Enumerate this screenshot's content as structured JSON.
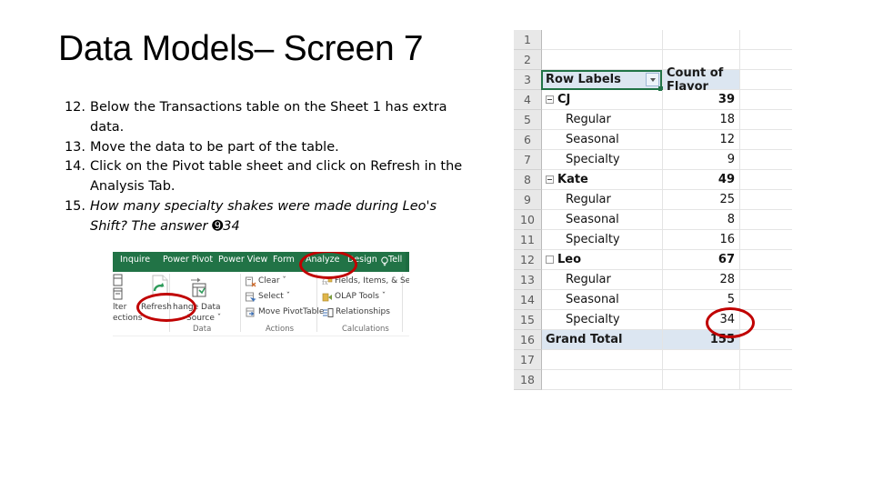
{
  "slide": {
    "title": "Data Models– Screen 7"
  },
  "instructions": [
    {
      "num": "12.",
      "text": "Below the Transactions table on the Sheet 1 has extra data.",
      "italic": false
    },
    {
      "num": "13.",
      "text": "Move the data to be part of the table.",
      "italic": false
    },
    {
      "num": "14.",
      "text": "Click on the Pivot table sheet and click on Refresh in the Analysis Tab.",
      "italic": false
    },
    {
      "num": "15.",
      "text": "How many specialty shakes were made during Leo's Shift? The answer ➒34",
      "italic": true
    }
  ],
  "ribbon": {
    "accent_color": "#217346",
    "highlight_color": "#c00000",
    "tabs": [
      {
        "label": "Inquire",
        "active": false
      },
      {
        "label": "Power Pivot",
        "active": false
      },
      {
        "label": "Power View",
        "active": false
      },
      {
        "label": "Form",
        "active": false
      },
      {
        "label": "Analyze",
        "active": true
      },
      {
        "label": "Design",
        "active": false
      },
      {
        "label": "Tell m",
        "active": false
      }
    ],
    "groups": [
      {
        "label": "Data"
      },
      {
        "label": "Actions"
      },
      {
        "label": "Calculations"
      }
    ],
    "commands": [
      {
        "label": "lter"
      },
      {
        "label": "ections"
      },
      {
        "label": "Refresh"
      },
      {
        "label": "hange Data"
      },
      {
        "label": "Source ˇ"
      },
      {
        "label": "Clear ˇ"
      },
      {
        "label": "Select ˇ"
      },
      {
        "label": "Move PivotTable"
      },
      {
        "label": "Fields, Items, & Sets ˇ"
      },
      {
        "label": "OLAP Tools ˇ"
      },
      {
        "label": "Relationships"
      }
    ],
    "circled": [
      "Analyze",
      "Refresh"
    ]
  },
  "pivot": {
    "header_fill": "#dce6f1",
    "columns": {
      "a": "Row Labels",
      "b": "Count of Flavor"
    },
    "rows": [
      {
        "n": "1",
        "a": "",
        "b": "",
        "kind": "blank",
        "indent": false,
        "expander": ""
      },
      {
        "n": "2",
        "a": "",
        "b": "",
        "kind": "blank",
        "indent": false,
        "expander": ""
      },
      {
        "n": "3",
        "a": "Row Labels",
        "b": "Count of Flavor",
        "kind": "hdr",
        "indent": false,
        "expander": ""
      },
      {
        "n": "4",
        "a": "CJ",
        "b": "39",
        "kind": "group",
        "indent": false,
        "expander": "minus"
      },
      {
        "n": "5",
        "a": "Regular",
        "b": "18",
        "kind": "item",
        "indent": true,
        "expander": ""
      },
      {
        "n": "6",
        "a": "Seasonal",
        "b": "12",
        "kind": "item",
        "indent": true,
        "expander": ""
      },
      {
        "n": "7",
        "a": "Specialty",
        "b": "9",
        "kind": "item",
        "indent": true,
        "expander": ""
      },
      {
        "n": "8",
        "a": "Kate",
        "b": "49",
        "kind": "group",
        "indent": false,
        "expander": "minus"
      },
      {
        "n": "9",
        "a": "Regular",
        "b": "25",
        "kind": "item",
        "indent": true,
        "expander": ""
      },
      {
        "n": "10",
        "a": "Seasonal",
        "b": "8",
        "kind": "item",
        "indent": true,
        "expander": ""
      },
      {
        "n": "11",
        "a": "Specialty",
        "b": "16",
        "kind": "item",
        "indent": true,
        "expander": ""
      },
      {
        "n": "12",
        "a": "Leo",
        "b": "67",
        "kind": "group",
        "indent": false,
        "expander": "box"
      },
      {
        "n": "13",
        "a": "Regular",
        "b": "28",
        "kind": "item",
        "indent": true,
        "expander": ""
      },
      {
        "n": "14",
        "a": "Seasonal",
        "b": "5",
        "kind": "item",
        "indent": true,
        "expander": ""
      },
      {
        "n": "15",
        "a": "Specialty",
        "b": "34",
        "kind": "item",
        "indent": true,
        "expander": ""
      },
      {
        "n": "16",
        "a": "Grand Total",
        "b": "155",
        "kind": "total",
        "indent": false,
        "expander": ""
      },
      {
        "n": "17",
        "a": "",
        "b": "",
        "kind": "blank",
        "indent": false,
        "expander": ""
      },
      {
        "n": "18",
        "a": "",
        "b": "",
        "kind": "blank",
        "indent": false,
        "expander": ""
      }
    ],
    "circled_value": "34"
  }
}
